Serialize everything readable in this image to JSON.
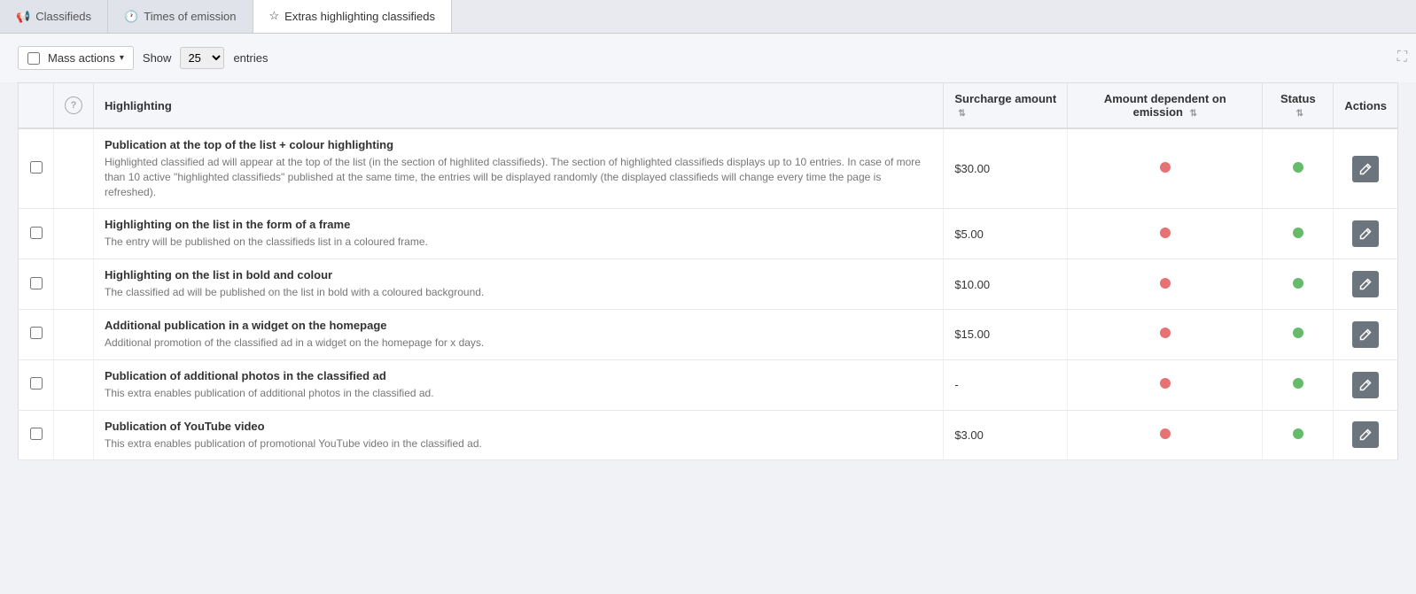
{
  "tabs": [
    {
      "id": "classifieds",
      "label": "Classifieds",
      "icon": "📢",
      "active": false
    },
    {
      "id": "times-of-emission",
      "label": "Times of emission",
      "icon": "🕐",
      "active": false
    },
    {
      "id": "extras-highlighting",
      "label": "Extras highlighting classifieds",
      "icon": "☆",
      "active": true
    }
  ],
  "toolbar": {
    "mass_actions_label": "Mass actions",
    "show_label": "Show",
    "entries_value": "25",
    "entries_label": "entries"
  },
  "table": {
    "columns": [
      {
        "id": "checkbox",
        "label": ""
      },
      {
        "id": "help",
        "label": ""
      },
      {
        "id": "highlighting",
        "label": "Highlighting"
      },
      {
        "id": "surcharge",
        "label": "Surcharge amount",
        "sortable": true
      },
      {
        "id": "amount_dep",
        "label": "Amount dependent on emission",
        "sortable": true
      },
      {
        "id": "status",
        "label": "Status",
        "sortable": true
      },
      {
        "id": "actions",
        "label": "Actions"
      }
    ],
    "rows": [
      {
        "id": 1,
        "title": "Publication at the top of the list + colour highlighting",
        "description": "Highlighted classified ad will appear at the top of the list (in the section of highlited classifieds). The section of highlighted classifieds displays up to 10 entries. In case of more than 10 active \"highlighted classifieds\" published at the same time, the entries will be displayed randomly (the displayed classifieds will change every time the page is refreshed).",
        "surcharge": "$30.00",
        "amount_dep_red": true,
        "status_green": true
      },
      {
        "id": 2,
        "title": "Highlighting on the list in the form of a frame",
        "description": "The entry will be published on the classifieds list in a coloured frame.",
        "surcharge": "$5.00",
        "amount_dep_red": true,
        "status_green": true
      },
      {
        "id": 3,
        "title": "Highlighting on the list in bold and colour",
        "description": "The classified ad will be published on the list in bold with a coloured background.",
        "surcharge": "$10.00",
        "amount_dep_red": true,
        "status_green": true
      },
      {
        "id": 4,
        "title": "Additional publication in a widget on the homepage",
        "description": "Additional promotion of the classified ad in a widget on the homepage for x days.",
        "surcharge": "$15.00",
        "amount_dep_red": true,
        "status_green": true
      },
      {
        "id": 5,
        "title": "Publication of additional photos in the classified ad",
        "description": "This extra enables publication of additional photos in the classified ad.",
        "surcharge": "-",
        "amount_dep_red": true,
        "status_green": true
      },
      {
        "id": 6,
        "title": "Publication of YouTube video",
        "description": "This extra enables publication of promotional YouTube video in the classified ad.",
        "surcharge": "$3.00",
        "amount_dep_red": true,
        "status_green": true
      }
    ]
  },
  "icons": {
    "edit": "✎",
    "fullscreen": "⛶",
    "caret_down": "▾",
    "sort": "⇅"
  }
}
